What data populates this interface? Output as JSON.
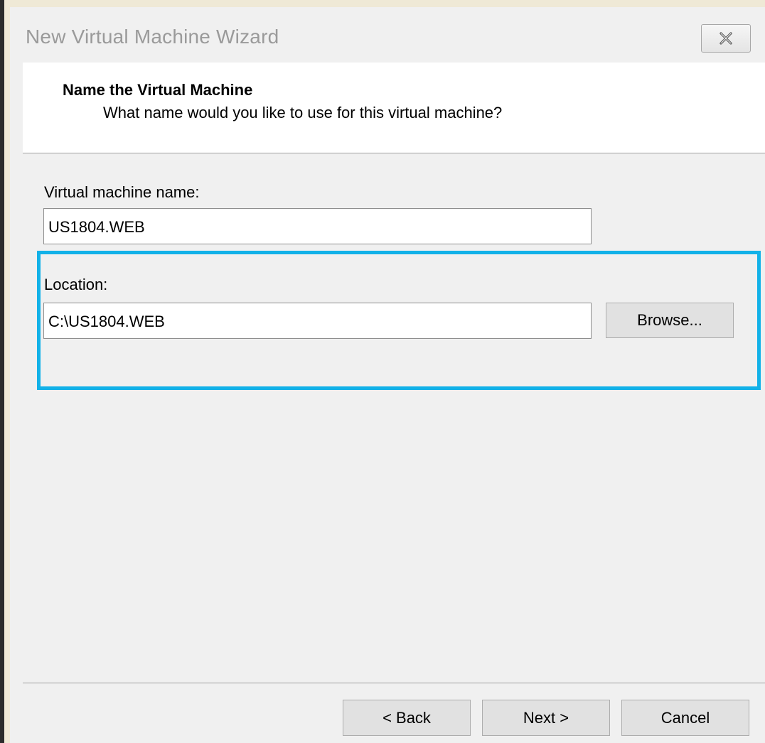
{
  "window": {
    "title": "New Virtual Machine Wizard",
    "close_icon": "close-icon"
  },
  "header": {
    "title": "Name the Virtual Machine",
    "subtitle": "What name would you like to use for this virtual machine?"
  },
  "form": {
    "name_label": "Virtual machine name:",
    "name_value": "US1804.WEB",
    "location_label": "Location:",
    "location_value": "C:\\US1804.WEB",
    "browse_label": "Browse..."
  },
  "footer": {
    "back_label": "< Back",
    "next_label": "Next >",
    "cancel_label": "Cancel"
  },
  "colors": {
    "highlight": "#12b1e8",
    "dialog_bg": "#f0f0f0",
    "header_bg": "#ffffff"
  }
}
